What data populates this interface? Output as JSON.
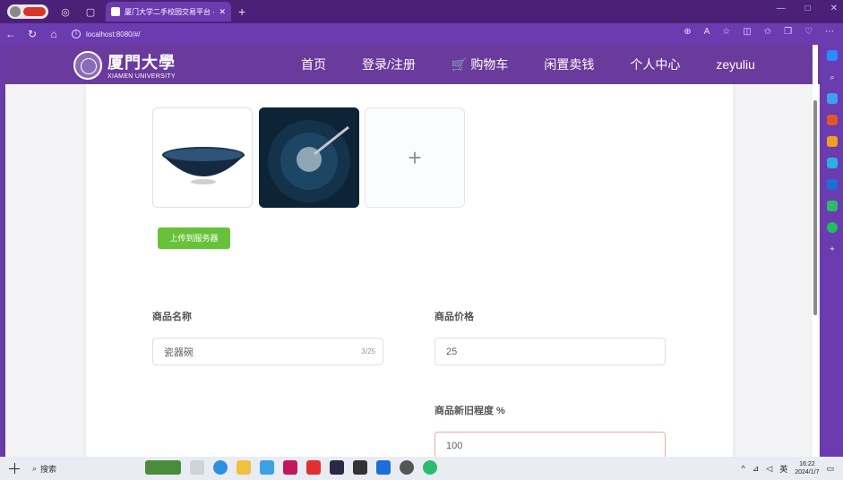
{
  "browser": {
    "tab_title": "厦门大学二手校园交易平台 - 首...",
    "address": "localhost:8080/#/",
    "window_controls": [
      "—",
      "□",
      "✕"
    ]
  },
  "header": {
    "logo_cn": "厦門大學",
    "logo_en": "XIAMEN UNIVERSITY",
    "menu": [
      {
        "label": "首页"
      },
      {
        "label": "登录/注册"
      },
      {
        "label": "购物车"
      },
      {
        "label": "闲置卖钱"
      },
      {
        "label": "个人中心"
      },
      {
        "label": "zeyuliu"
      }
    ]
  },
  "upload": {
    "add_symbol": "+",
    "upload_button": "上传到服务器"
  },
  "form": {
    "name_label": "商品名称",
    "name_value": "瓷器碗",
    "name_counter": "3/25",
    "price_label": "商品价格",
    "price_value": "25",
    "condition_label": "商品新旧程度 %",
    "condition_value": "100"
  },
  "taskbar": {
    "search_label": "搜索",
    "tray_lang": "英",
    "time": "16:22",
    "date": "2024/1/7"
  }
}
